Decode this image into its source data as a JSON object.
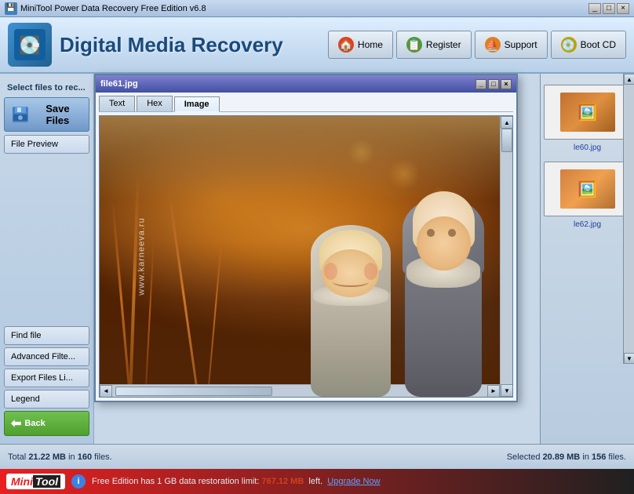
{
  "titlebar": {
    "text": "MiniTool Power Data Recovery Free Edition v6.8",
    "controls": [
      "_",
      "□",
      "×"
    ]
  },
  "header": {
    "title": "Digital Media Recovery",
    "buttons": [
      {
        "id": "home",
        "label": "Home",
        "icon": "🏠"
      },
      {
        "id": "register",
        "label": "Register",
        "icon": "📝"
      },
      {
        "id": "support",
        "label": "Support",
        "icon": "🔵"
      },
      {
        "id": "boot",
        "label": "Boot CD",
        "icon": "💿"
      }
    ]
  },
  "sidebar": {
    "select_label": "Select files to rec...",
    "save_btn": "Save Files",
    "file_preview_btn": "File Preview",
    "find_file_btn": "Find file",
    "advanced_filter_btn": "Advanced Filte...",
    "export_files_btn": "Export Files Li...",
    "legend_btn": "Legend",
    "back_btn": "Back"
  },
  "popup": {
    "title": "file61.jpg",
    "tabs": [
      "Text",
      "Hex",
      "Image"
    ],
    "active_tab": "Image",
    "watermark": "www.karneeva.ru",
    "controls": [
      "_",
      "□",
      "×"
    ]
  },
  "right_panel": {
    "files": [
      {
        "name": "le60.jpg",
        "icon": "🖼️"
      },
      {
        "name": "le62.jpg",
        "icon": "🖼️"
      }
    ]
  },
  "status": {
    "total_text": "Total",
    "total_size": "21.22 MB",
    "total_in": "in",
    "total_count": "160",
    "total_files": "files.",
    "selected_text": "Selected",
    "selected_size": "20.89 MB",
    "selected_in": "in",
    "selected_count": "156",
    "selected_files": "files."
  },
  "bottom": {
    "logo_mini": "Mini",
    "logo_tool": "Tool",
    "free_edition_msg": "Free Edition has 1 GB data restoration limit:",
    "mb_left": "767.12 MB",
    "left_text": "left.",
    "upgrade_label": "Upgrade Now"
  }
}
